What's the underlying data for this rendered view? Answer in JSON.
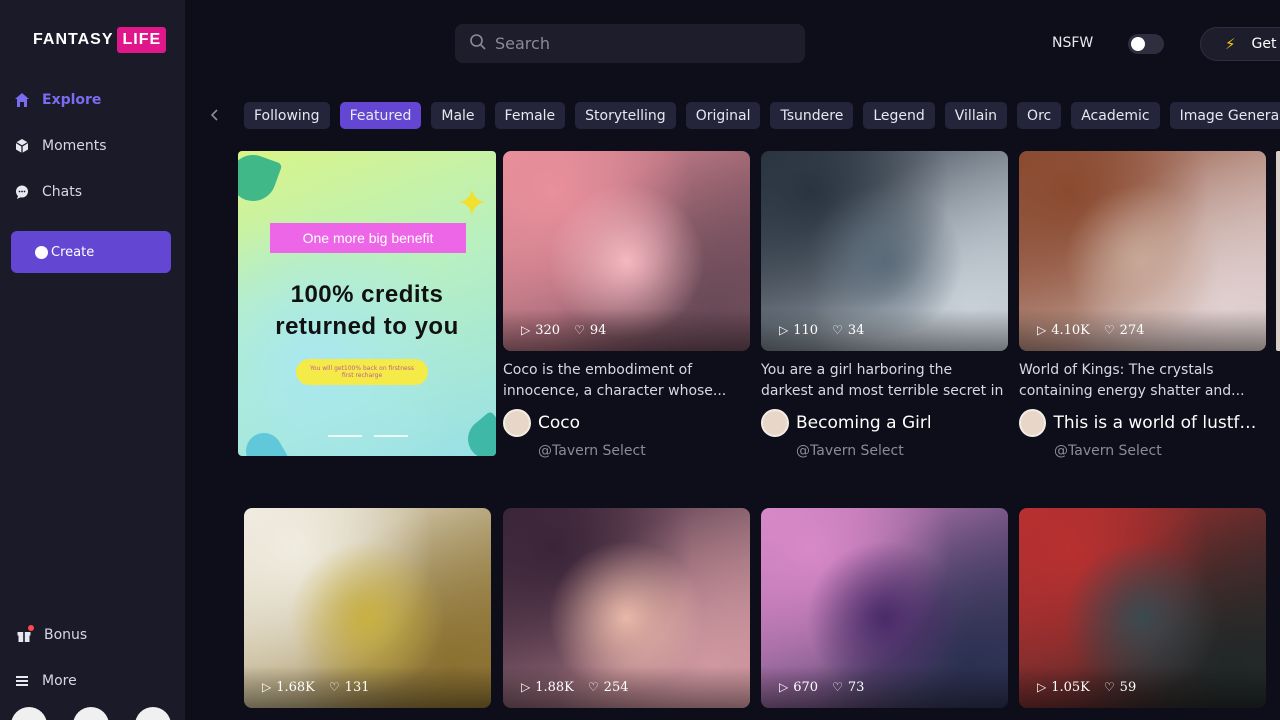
{
  "brand": {
    "fantasy": "FANTASY",
    "life": "LIFE"
  },
  "sidebar": {
    "items": [
      {
        "label": "Explore",
        "icon": "home-icon",
        "active": true
      },
      {
        "label": "Moments",
        "icon": "cube-icon"
      },
      {
        "label": "Chats",
        "icon": "chat-bubble-icon"
      }
    ],
    "create_label": "Create",
    "bottom": [
      {
        "label": "Bonus",
        "icon": "gift-icon"
      },
      {
        "label": "More",
        "icon": "menu-icon"
      }
    ]
  },
  "header": {
    "search_placeholder": "Search",
    "nsfw_label": "NSFW",
    "nsfw_enabled": false,
    "get_label": "Get"
  },
  "tabs": [
    "Following",
    "Featured",
    "Male",
    "Female",
    "Storytelling",
    "Original",
    "Tsundere",
    "Legend",
    "Villain",
    "Orc",
    "Academic",
    "Image Genera"
  ],
  "active_tab": "Featured",
  "promo": {
    "pill": "One more big benefit",
    "line1": "100% credits",
    "line2": "returned to you",
    "small": "You will get100% back on firstness first recharge"
  },
  "cards_row1": [
    {
      "plays": "320",
      "likes": "94",
      "desc": "Coco is the embodiment of innocence, a character whose...",
      "name": "Coco",
      "author": "@Tavern Select",
      "colors": [
        "#f4b8c0",
        "#e8909c",
        "#6a4a58"
      ]
    },
    {
      "plays": "110",
      "likes": "34",
      "desc": "You are a girl harboring the darkest and most terrible secret in this...",
      "name": "Becoming a Girl",
      "author": "@Tavern Select",
      "colors": [
        "#5a6a78",
        "#2a3440",
        "#c8d0d8"
      ]
    },
    {
      "plays": "4.10K",
      "likes": "274",
      "desc": "World of Kings: The crystals containing energy shatter and...",
      "name": "This is a world of lustful...",
      "author": "@Tavern Select",
      "colors": [
        "#c8a898",
        "#8a4a30",
        "#e0d0d0"
      ]
    }
  ],
  "cards_row2": [
    {
      "plays": "1.68K",
      "likes": "131",
      "colors": [
        "#c8b040",
        "#f0ece0",
        "#8a7030"
      ]
    },
    {
      "plays": "1.88K",
      "likes": "254",
      "colors": [
        "#e8b8a8",
        "#3a2438",
        "#d098a0"
      ]
    },
    {
      "plays": "670",
      "likes": "73",
      "colors": [
        "#4a2a68",
        "#d888c8",
        "#2a3050"
      ]
    },
    {
      "plays": "1.05K",
      "likes": "59",
      "colors": [
        "#3a4a50",
        "#b83030",
        "#202828"
      ]
    }
  ]
}
